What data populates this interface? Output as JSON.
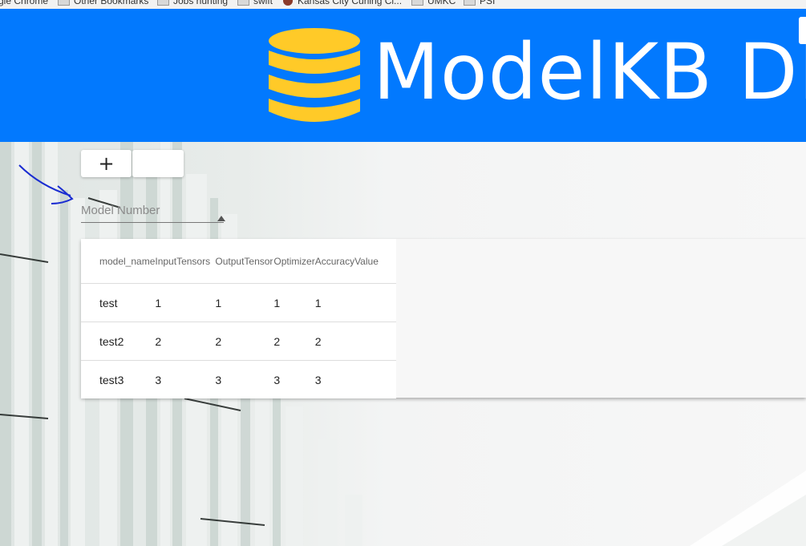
{
  "bookmarks": [
    {
      "label": "gle Chrome",
      "icon": "none"
    },
    {
      "label": "Other Bookmarks",
      "icon": "folder-icon"
    },
    {
      "label": "Jobs hunting",
      "icon": "folder-icon"
    },
    {
      "label": "swift",
      "icon": "folder-icon"
    },
    {
      "label": "Kansas City Curling Cl...",
      "icon": "site-favicon"
    },
    {
      "label": "UMKC",
      "icon": "folder-icon"
    },
    {
      "label": "PSI",
      "icon": "folder-icon"
    }
  ],
  "header": {
    "title": "ModelKB DB",
    "background_color": "#0279fe",
    "logo_icon": "database-icon",
    "logo_color": "#ffca28"
  },
  "toolbar": {
    "add_label": "+",
    "blank_label": ""
  },
  "search": {
    "placeholder": "Model Number",
    "value": ""
  },
  "table": {
    "columns": [
      "model_name",
      "InputTensors",
      "OutputTensor",
      "Optimizer",
      "AccuracyValue"
    ],
    "rows": [
      [
        "test",
        "1",
        "1",
        "1",
        "1"
      ],
      [
        "test2",
        "2",
        "2",
        "2",
        "2"
      ],
      [
        "test3",
        "3",
        "3",
        "3",
        "3"
      ]
    ]
  }
}
